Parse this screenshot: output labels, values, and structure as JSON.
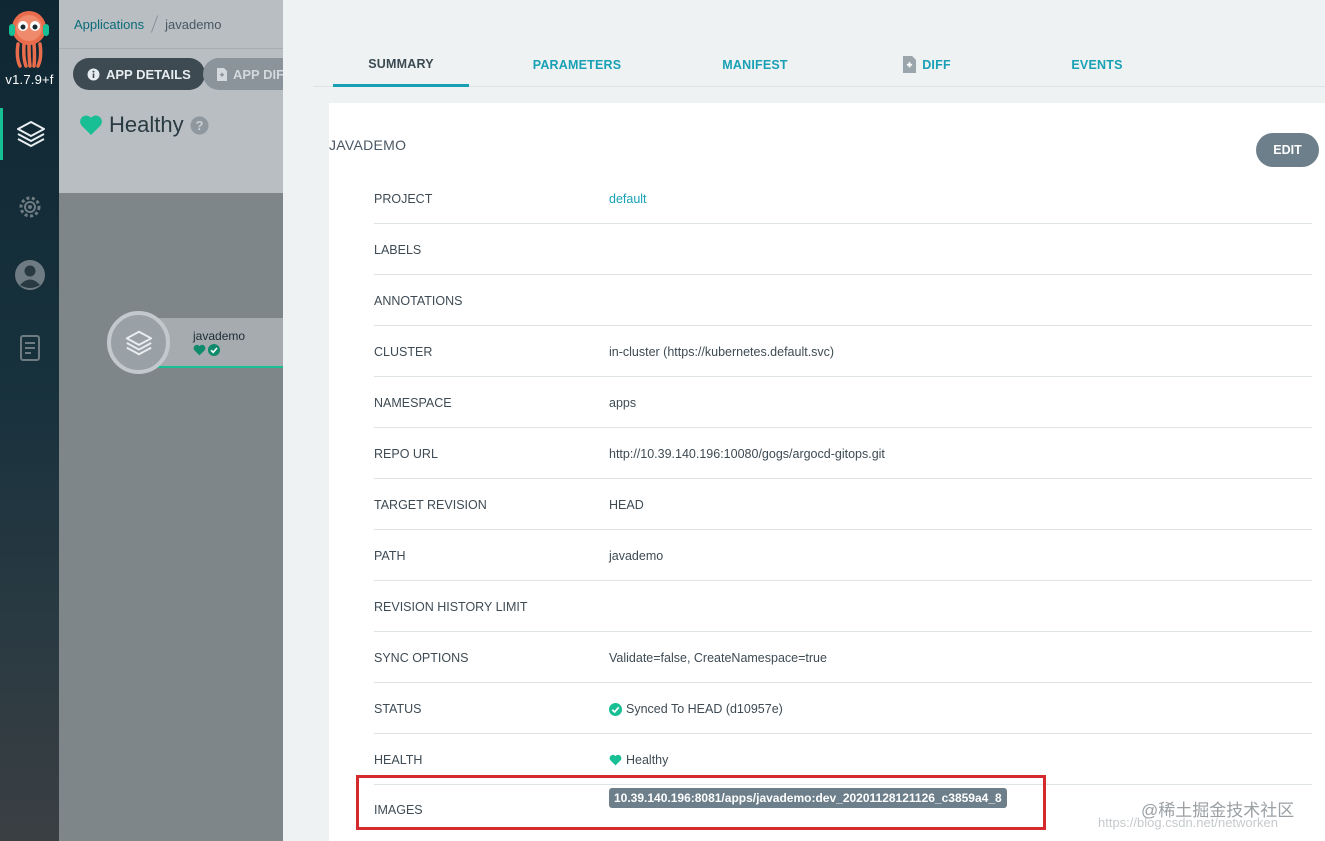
{
  "nav": {
    "version": "v1.7.9+f",
    "items": [
      {
        "icon": "layers-icon",
        "active": true
      },
      {
        "icon": "gear-icon",
        "active": false
      },
      {
        "icon": "user-icon",
        "active": false
      },
      {
        "icon": "docs-icon",
        "active": false
      }
    ]
  },
  "breadcrumb": {
    "link": "Applications",
    "current": "javademo"
  },
  "toolbar": {
    "details_label": "APP DETAILS",
    "diff_label": "APP DIFF"
  },
  "app_health": "Healthy",
  "node": {
    "name": "javademo"
  },
  "tabs": [
    {
      "label": "SUMMARY",
      "active": true
    },
    {
      "label": "PARAMETERS",
      "active": false
    },
    {
      "label": "MANIFEST",
      "active": false
    },
    {
      "label": "DIFF",
      "active": false
    },
    {
      "label": "EVENTS",
      "active": false
    }
  ],
  "summary": {
    "title": "JAVADEMO",
    "edit_label": "EDIT",
    "rows": [
      {
        "label": "PROJECT",
        "value": "default"
      },
      {
        "label": "LABELS",
        "value": ""
      },
      {
        "label": "ANNOTATIONS",
        "value": ""
      },
      {
        "label": "CLUSTER",
        "value": "in-cluster (https://kubernetes.default.svc)"
      },
      {
        "label": "NAMESPACE",
        "value": "apps"
      },
      {
        "label": "REPO URL",
        "value": "http://10.39.140.196:10080/gogs/argocd-gitops.git"
      },
      {
        "label": "TARGET REVISION",
        "value": "HEAD"
      },
      {
        "label": "PATH",
        "value": "javademo"
      },
      {
        "label": "REVISION HISTORY LIMIT",
        "value": ""
      },
      {
        "label": "SYNC OPTIONS",
        "value": "Validate=false, CreateNamespace=true"
      },
      {
        "label": "STATUS",
        "value": "Synced To HEAD (d10957e)"
      },
      {
        "label": "HEALTH",
        "value": "Healthy"
      },
      {
        "label": "IMAGES",
        "value": "10.39.140.196:8081/apps/javademo:dev_20201128121126_c3859a4_8"
      }
    ]
  },
  "colors": {
    "accent": "#18a0b4",
    "healthy": "#18be94",
    "highlight": "#d42a2e"
  },
  "watermark": {
    "line1": "@稀土掘金技术社区",
    "line2": "https://blog.csdn.net/networken"
  }
}
